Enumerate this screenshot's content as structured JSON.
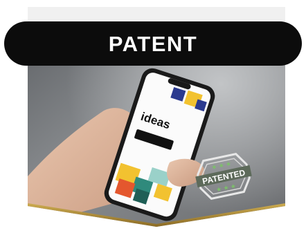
{
  "banner": {
    "title": "PATENT"
  },
  "photo": {
    "phone_screen_heading": "ideas"
  },
  "badge": {
    "label": "PATENTED"
  },
  "colors": {
    "banner": "#0c0c0c",
    "accent_gold": "#b0903c",
    "frame_top": "#f0f0f0"
  }
}
